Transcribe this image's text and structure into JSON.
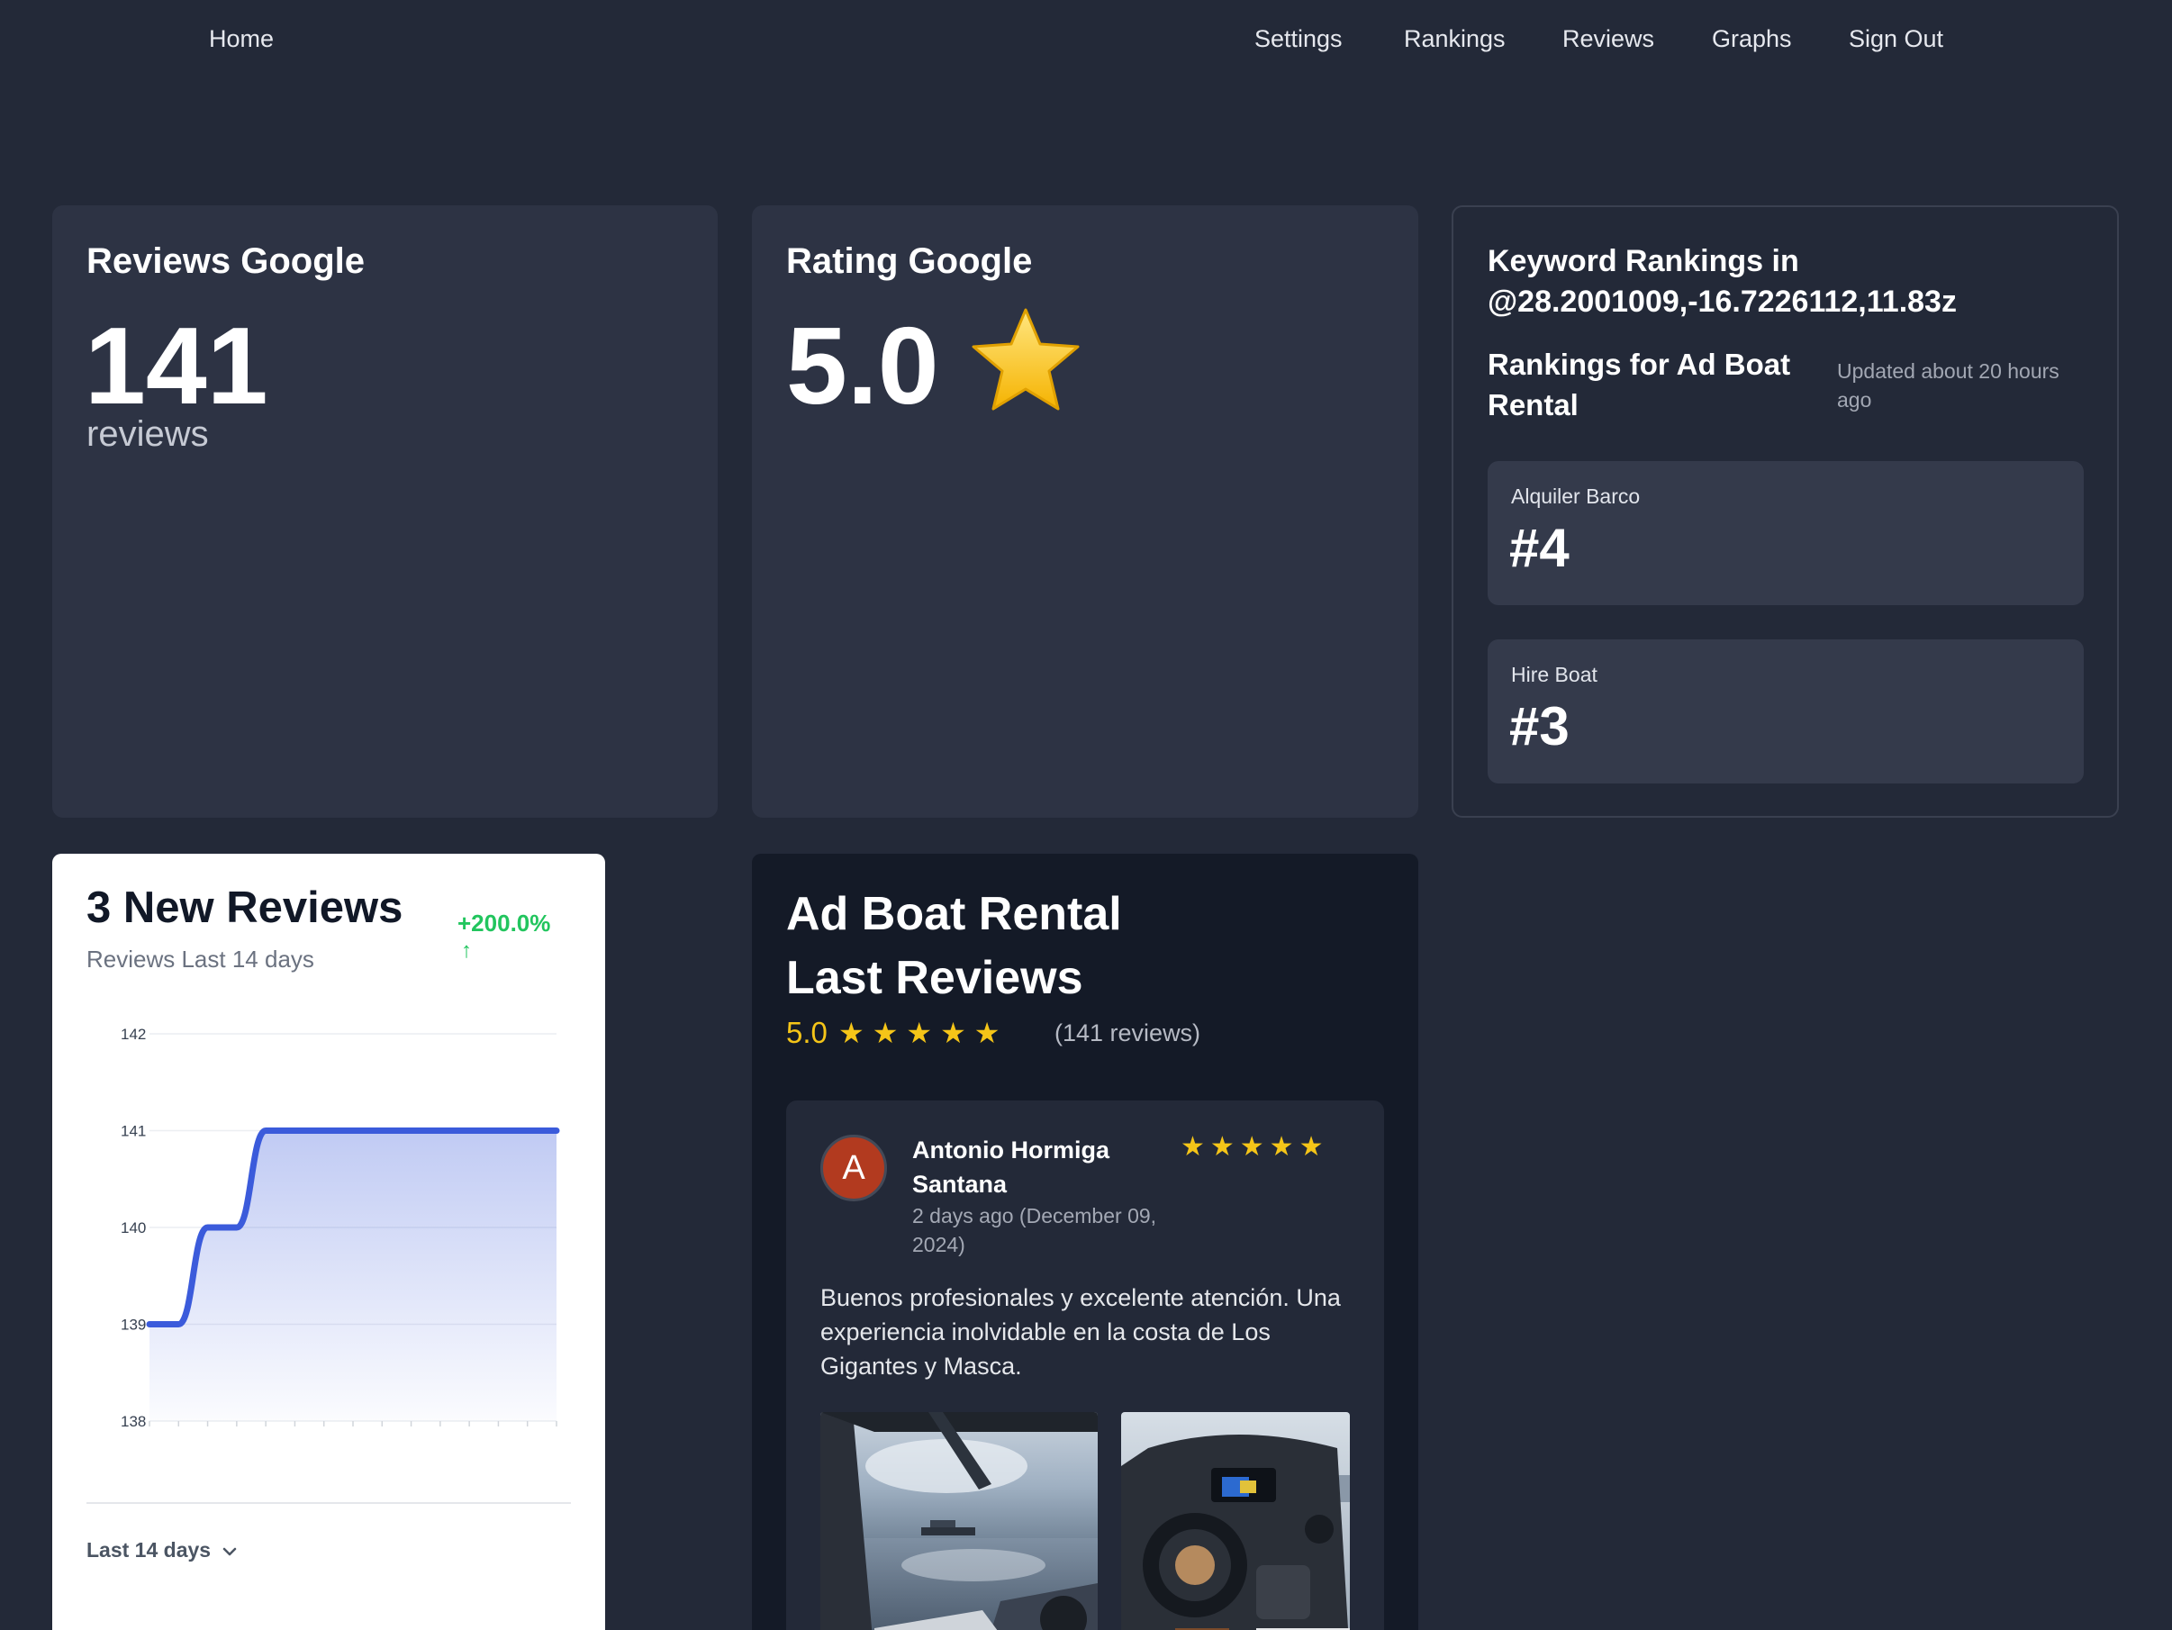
{
  "nav": {
    "home": "Home",
    "settings": "Settings",
    "rankings": "Rankings",
    "reviews": "Reviews",
    "graphs": "Graphs",
    "sign_out": "Sign Out"
  },
  "reviews_card": {
    "title": "Reviews Google",
    "count": "141",
    "unit": "reviews"
  },
  "rating_card": {
    "title": "Rating Google",
    "value": "5.0",
    "icon": "star-icon"
  },
  "keyword_card": {
    "title": "Keyword Rankings in @28.2001009,-16.7226112,11.83z",
    "subtitle": "Rankings for Ad Boat Rental",
    "updated": "Updated about 20 hours ago",
    "keywords": [
      {
        "label": "Alquiler Barco",
        "rank": "#4"
      },
      {
        "label": "Hire Boat",
        "rank": "#3"
      }
    ]
  },
  "new_reviews_card": {
    "title": "3 New Reviews",
    "subtitle": "Reviews Last 14 days",
    "change": "+200.0%",
    "change_arrow": "↑",
    "period": "Last 14 days",
    "chart_data": {
      "type": "area",
      "x": [
        1,
        2,
        3,
        4,
        5,
        6,
        7,
        8,
        9,
        10,
        11,
        12,
        13,
        14,
        15
      ],
      "values": [
        139,
        139,
        140,
        140,
        141,
        141,
        141,
        141,
        141,
        141,
        141,
        141,
        141,
        141,
        141
      ],
      "ylim": [
        138,
        142
      ],
      "yticks": [
        "142",
        "141",
        "140",
        "139",
        "138"
      ],
      "line_color": "#3b5bdb",
      "grid": true
    }
  },
  "last_reviews": {
    "title_line1": "Ad Boat Rental",
    "title_line2": "Last Reviews",
    "rating": "5.0",
    "stars": "★★★★★",
    "count": "(141 reviews)",
    "review": {
      "avatar_letter": "A",
      "avatar_color": "#b23a1f",
      "name": "Antonio Hormiga Santana",
      "date": "2 days ago (December 09, 2024)",
      "stars": "★★★★★",
      "text": "Buenos profesionales y excelente atención. Una experiencia inolvidable en la costa de Los Gigantes y Masca."
    }
  },
  "colors": {
    "background": "#232938",
    "card": "#2d3344",
    "accent_star": "#f5c518",
    "positive": "#22c55e",
    "chart_line": "#3b5bdb"
  }
}
